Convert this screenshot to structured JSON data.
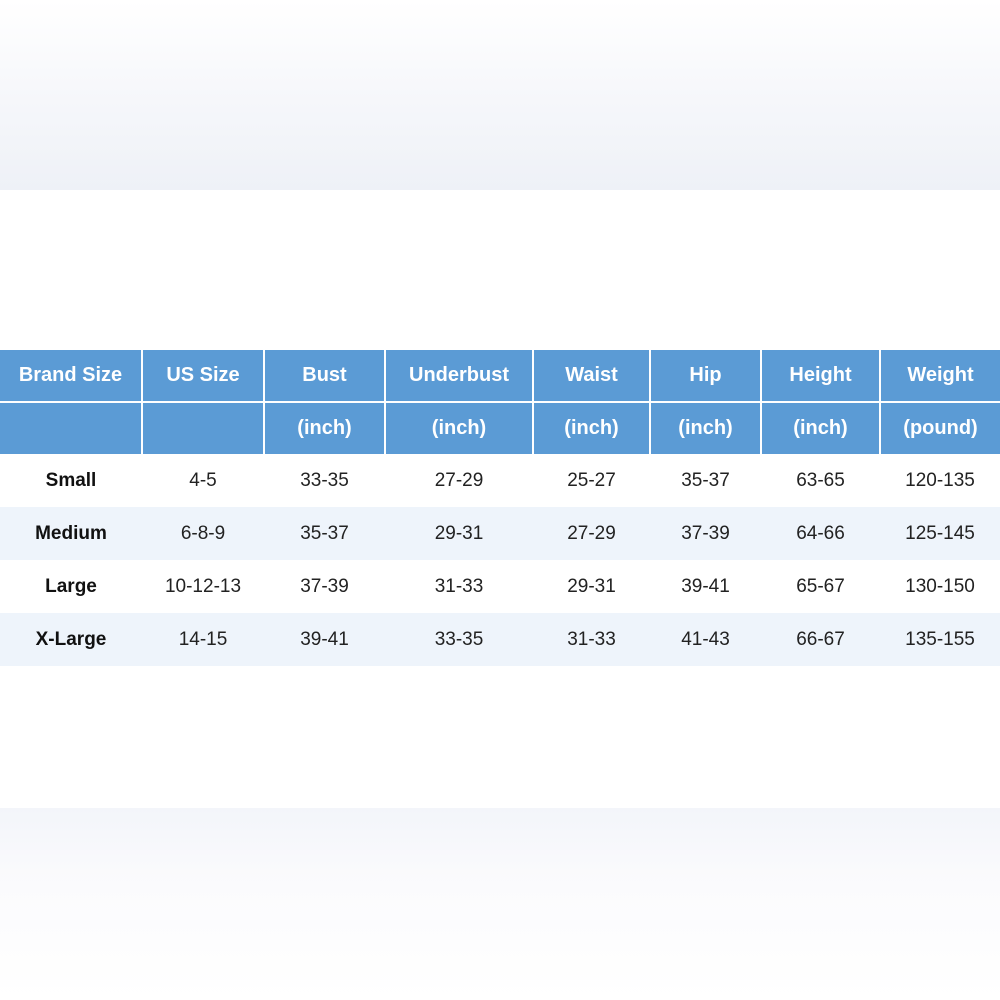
{
  "table": {
    "headers": [
      "Brand Size",
      "US Size",
      "Bust",
      "Underbust",
      "Waist",
      "Hip",
      "Height",
      "Weight"
    ],
    "units": [
      "",
      "",
      "(inch)",
      "(inch)",
      "(inch)",
      "(inch)",
      "(inch)",
      "(pound)"
    ],
    "rows": [
      [
        "Small",
        "4-5",
        "33-35",
        "27-29",
        "25-27",
        "35-37",
        "63-65",
        "120-135"
      ],
      [
        "Medium",
        "6-8-9",
        "35-37",
        "29-31",
        "27-29",
        "37-39",
        "64-66",
        "125-145"
      ],
      [
        "Large",
        "10-12-13",
        "37-39",
        "31-33",
        "29-31",
        "39-41",
        "65-67",
        "130-150"
      ],
      [
        "X-Large",
        "14-15",
        "39-41",
        "33-35",
        "31-33",
        "41-43",
        "66-67",
        "135-155"
      ]
    ]
  },
  "colors": {
    "header_bg": "#5b9bd5",
    "header_text": "#ffffff",
    "row_alt_bg": "#eef4fb"
  }
}
